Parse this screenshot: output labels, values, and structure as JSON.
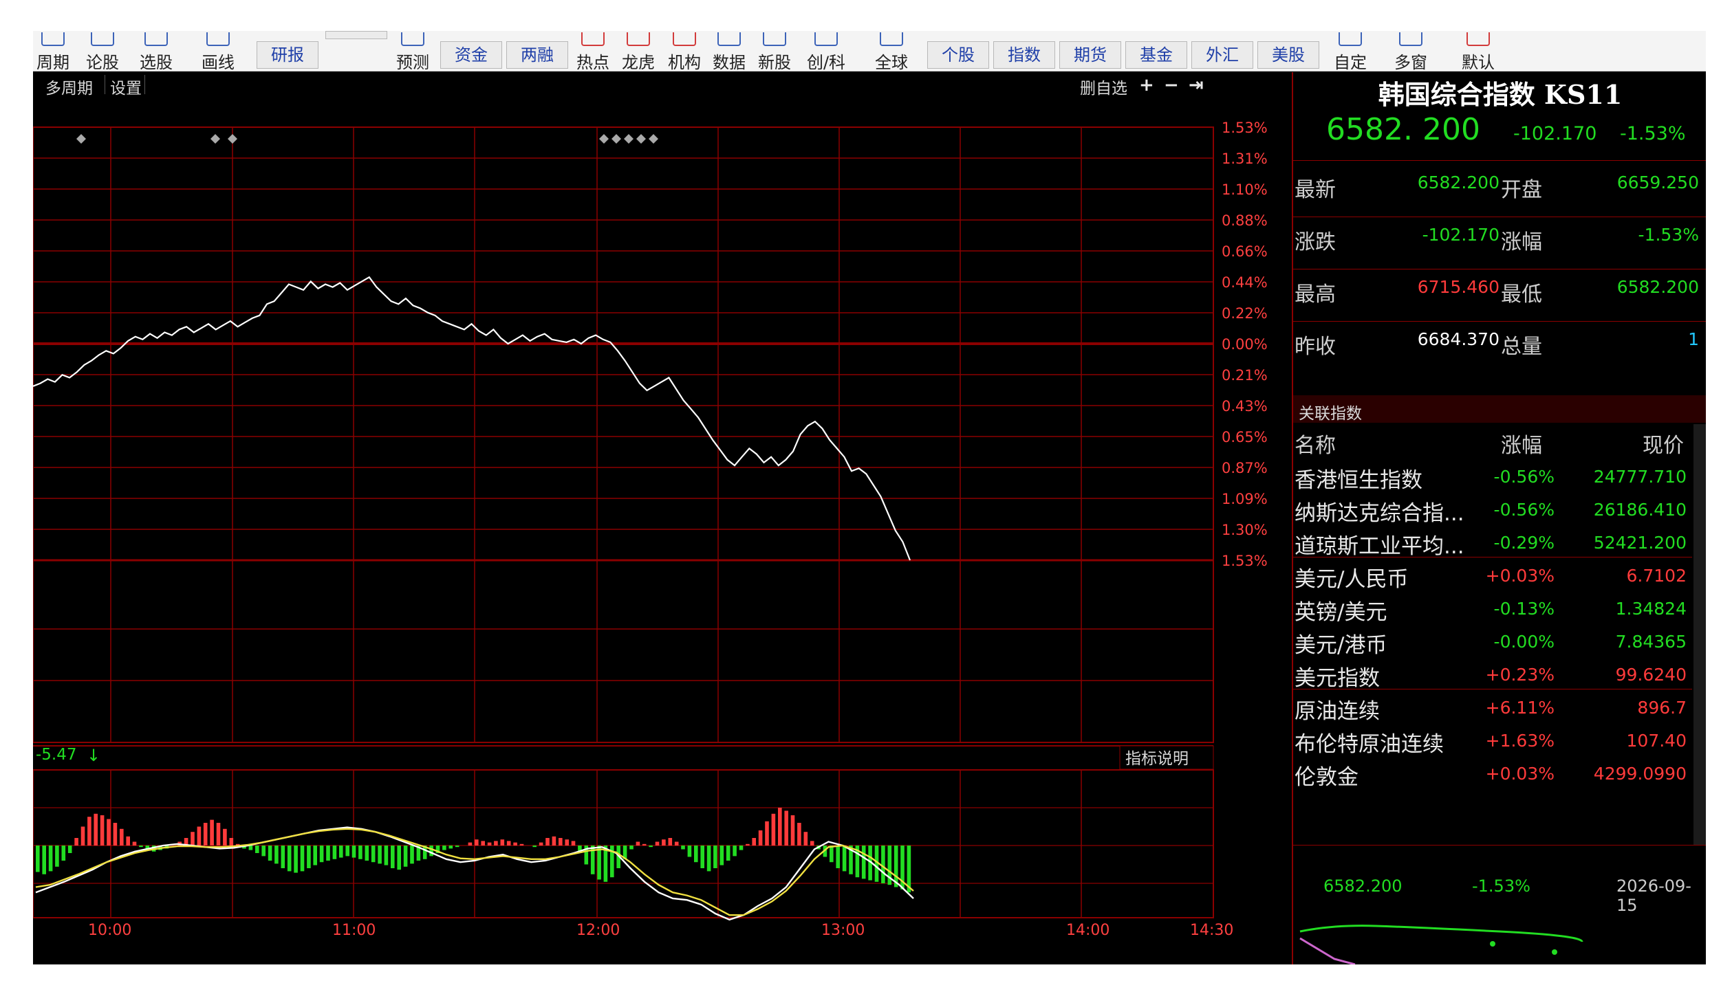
{
  "toolbar": {
    "icons": [
      {
        "label": "周期"
      },
      {
        "label": "论股"
      },
      {
        "label": "选股"
      },
      {
        "label": "画线"
      }
    ],
    "yanbao": "研报",
    "yuce": "预测",
    "zijin": "资金",
    "liangrong": "两融",
    "icons2": [
      {
        "label": "热点"
      },
      {
        "label": "龙虎"
      },
      {
        "label": "机构"
      },
      {
        "label": "数据"
      },
      {
        "label": "新股"
      },
      {
        "label": "创/科"
      },
      {
        "label": "全球"
      }
    ],
    "tabs": [
      "个股",
      "指数",
      "期货",
      "基金",
      "外汇",
      "美股"
    ],
    "icons3": [
      {
        "label": "自定"
      },
      {
        "label": "多窗"
      },
      {
        "label": "默认"
      }
    ]
  },
  "chart_header": {
    "multi_period": "多周期",
    "settings": "设置",
    "delete_fav": "删自选",
    "icons": [
      "plus-icon",
      "minus-icon",
      "arrow-right-bar-icon"
    ]
  },
  "chart_data": {
    "type": "line",
    "x_ticks": [
      "10:00",
      "11:00",
      "12:00",
      "13:00",
      "14:00",
      "14:30"
    ],
    "y_ticks_top": [
      "1.53%",
      "1.31%",
      "1.10%",
      "0.88%",
      "0.66%",
      "0.44%",
      "0.22%",
      "0.00%"
    ],
    "y_ticks_bottom": [
      "0.21%",
      "0.43%",
      "0.65%",
      "0.87%",
      "1.09%",
      "1.30%",
      "1.53%"
    ],
    "ylim": [
      -1.53,
      1.53
    ],
    "prev_close": 6684.37,
    "series": [
      {
        "values": [
          -0.3,
          -0.28,
          -0.25,
          -0.27,
          -0.22,
          -0.24,
          -0.2,
          -0.15,
          -0.12,
          -0.08,
          -0.05,
          -0.07,
          -0.03,
          0.02,
          0.05,
          0.03,
          0.07,
          0.04,
          0.08,
          0.06,
          0.1,
          0.12,
          0.08,
          0.11,
          0.14,
          0.1,
          0.13,
          0.16,
          0.12,
          0.15,
          0.18,
          0.2,
          0.28,
          0.3,
          0.36,
          0.42,
          0.4,
          0.38,
          0.44,
          0.39,
          0.42,
          0.4,
          0.43,
          0.38,
          0.41,
          0.44,
          0.47,
          0.4,
          0.35,
          0.3,
          0.28,
          0.32,
          0.27,
          0.25,
          0.22,
          0.2,
          0.16,
          0.14,
          0.12,
          0.1,
          0.14,
          0.09,
          0.06,
          0.1,
          0.04,
          0.0,
          0.03,
          0.06,
          0.02,
          0.05,
          0.07,
          0.03,
          0.02,
          0.01,
          0.03,
          0.0,
          0.04,
          0.06,
          0.03,
          0.01,
          -0.05,
          -0.12,
          -0.2,
          -0.28,
          -0.33,
          -0.3,
          -0.27,
          -0.24,
          -0.32,
          -0.4,
          -0.46,
          -0.52,
          -0.6,
          -0.68,
          -0.75,
          -0.82,
          -0.86,
          -0.8,
          -0.74,
          -0.78,
          -0.84,
          -0.8,
          -0.86,
          -0.82,
          -0.76,
          -0.64,
          -0.58,
          -0.55,
          -0.6,
          -0.68,
          -0.74,
          -0.8,
          -0.9,
          -0.88,
          -0.92,
          -1.0,
          -1.08,
          -1.2,
          -1.32,
          -1.4,
          -1.53
        ]
      },
      {
        "values": [
          -0.62,
          -0.55,
          -0.48,
          -0.4,
          -0.32,
          -0.22,
          -0.14,
          -0.08,
          -0.04,
          0.0,
          0.02,
          0.0,
          -0.02,
          -0.04,
          -0.03,
          0.0,
          0.04,
          0.08,
          0.12,
          0.16,
          0.2,
          0.22,
          0.24,
          0.22,
          0.18,
          0.12,
          0.05,
          -0.02,
          -0.1,
          -0.18,
          -0.22,
          -0.2,
          -0.15,
          -0.12,
          -0.18,
          -0.22,
          -0.2,
          -0.15,
          -0.1,
          -0.04,
          -0.02,
          -0.1,
          -0.3,
          -0.48,
          -0.62,
          -0.7,
          -0.72,
          -0.78,
          -0.9,
          -0.98,
          -0.92,
          -0.8,
          -0.7,
          -0.55,
          -0.3,
          -0.05,
          0.05,
          0.0,
          -0.1,
          -0.22,
          -0.38,
          -0.52,
          -0.7
        ]
      },
      {
        "values": [
          -0.55,
          -0.52,
          -0.45,
          -0.38,
          -0.3,
          -0.22,
          -0.16,
          -0.1,
          -0.06,
          -0.03,
          -0.01,
          -0.01,
          -0.02,
          -0.02,
          -0.01,
          0.01,
          0.04,
          0.08,
          0.12,
          0.16,
          0.19,
          0.21,
          0.22,
          0.21,
          0.18,
          0.13,
          0.07,
          0.01,
          -0.05,
          -0.12,
          -0.17,
          -0.18,
          -0.16,
          -0.14,
          -0.16,
          -0.18,
          -0.18,
          -0.15,
          -0.11,
          -0.07,
          -0.05,
          -0.09,
          -0.22,
          -0.38,
          -0.52,
          -0.62,
          -0.66,
          -0.72,
          -0.82,
          -0.92,
          -0.92,
          -0.84,
          -0.74,
          -0.6,
          -0.4,
          -0.18,
          -0.02,
          0.0,
          -0.06,
          -0.16,
          -0.3,
          -0.44,
          -0.6
        ]
      },
      {
        "values": [
          -0.35,
          -0.38,
          -0.34,
          -0.28,
          -0.2,
          -0.1,
          0.1,
          0.25,
          0.38,
          0.42,
          0.4,
          0.35,
          0.3,
          0.22,
          0.12,
          0.05,
          -0.02,
          -0.05,
          -0.08,
          -0.06,
          -0.04,
          0.0,
          0.05,
          0.1,
          0.18,
          0.25,
          0.3,
          0.34,
          0.3,
          0.22,
          0.1,
          0.02,
          -0.04,
          -0.06,
          -0.1,
          -0.14,
          -0.2,
          -0.24,
          -0.3,
          -0.34,
          -0.36,
          -0.34,
          -0.3,
          -0.26,
          -0.22,
          -0.2,
          -0.18,
          -0.16,
          -0.14,
          -0.16,
          -0.18,
          -0.2,
          -0.22,
          -0.24,
          -0.26,
          -0.3,
          -0.32,
          -0.28,
          -0.24,
          -0.2,
          -0.18,
          -0.14,
          -0.1,
          -0.06,
          -0.04,
          -0.02,
          0.0,
          0.04,
          0.08,
          0.06,
          0.04,
          0.06,
          0.08,
          0.06,
          0.04,
          0.02,
          0.0,
          -0.02,
          0.04,
          0.1,
          0.12,
          0.1,
          0.08,
          0.06,
          -0.1,
          -0.25,
          -0.38,
          -0.45,
          -0.48,
          -0.42,
          -0.3,
          -0.18,
          -0.05,
          0.05,
          0.02,
          -0.02,
          0.05,
          0.08,
          0.1,
          0.05,
          -0.05,
          -0.15,
          -0.22,
          -0.3,
          -0.34,
          -0.3,
          -0.26,
          -0.2,
          -0.14,
          -0.06,
          0.02,
          0.1,
          0.2,
          0.32,
          0.42,
          0.5,
          0.46,
          0.4,
          0.3,
          0.18,
          0.06,
          -0.05,
          -0.15,
          -0.22,
          -0.3,
          -0.34,
          -0.38,
          -0.42,
          -0.44,
          -0.46,
          -0.48,
          -0.5,
          -0.52,
          -0.55,
          -0.58,
          -0.62
        ]
      }
    ],
    "indicator_value": "-5.47",
    "indicator_info": "指标说明"
  },
  "quote": {
    "title": "韩国综合指数 KS11",
    "price": "6582. 200",
    "change": "-102.170",
    "change_pct": "-1.53%",
    "rows": [
      {
        "l1": "最新",
        "v1": "6582.200",
        "l2": "开盘",
        "v2": "6659.250",
        "c1": "#22dd22",
        "c2": "#22dd22"
      },
      {
        "l1": "涨跌",
        "v1": "-102.170",
        "l2": "涨幅",
        "v2": "-1.53%",
        "c1": "#22dd22",
        "c2": "#22dd22"
      },
      {
        "l1": "最高",
        "v1": "6715.460",
        "l2": "最低",
        "v2": "6582.200",
        "c1": "#ff3b3b",
        "c2": "#22dd22"
      },
      {
        "l1": "昨收",
        "v1": "6684.370",
        "l2": "总量",
        "v2": "1",
        "c1": "#ffffff",
        "c2": "#22c8ff"
      }
    ]
  },
  "related": {
    "title": "关联指数",
    "col_name": "名称",
    "col_pct": "涨幅",
    "col_price": "现价",
    "rows": [
      {
        "name": "香港恒生指数",
        "pct": "-0.56%",
        "price": "24777.710",
        "color": "#22dd22"
      },
      {
        "name": "纳斯达克综合指...",
        "pct": "-0.56%",
        "price": "26186.410",
        "color": "#22dd22"
      },
      {
        "name": "道琼斯工业平均...",
        "pct": "-0.29%",
        "price": "52421.200",
        "color": "#22dd22"
      },
      {
        "name": "美元/人民币",
        "pct": "+0.03%",
        "price": "6.7102",
        "color": "#ff3b3b"
      },
      {
        "name": "英镑/美元",
        "pct": "-0.13%",
        "price": "1.34824",
        "color": "#22dd22"
      },
      {
        "name": "美元/港币",
        "pct": "-0.00%",
        "price": "7.84365",
        "color": "#22dd22"
      },
      {
        "name": "美元指数",
        "pct": "+0.23%",
        "price": "99.6240",
        "color": "#ff3b3b"
      },
      {
        "name": "原油连续",
        "pct": "+6.11%",
        "price": "896.7",
        "color": "#ff3b3b"
      },
      {
        "name": "布伦特原油连续",
        "pct": "+1.63%",
        "price": "107.40",
        "color": "#ff3b3b"
      },
      {
        "name": "伦敦金",
        "pct": "+0.03%",
        "price": "4299.0990",
        "color": "#ff3b3b"
      }
    ]
  },
  "mini": {
    "price": "6582.200",
    "pct": "-1.53%",
    "date": "2026-09-15"
  },
  "colors": {
    "up": "#ff3b3b",
    "down": "#22dd22",
    "grid": "#8b0000",
    "background": "#000000"
  }
}
